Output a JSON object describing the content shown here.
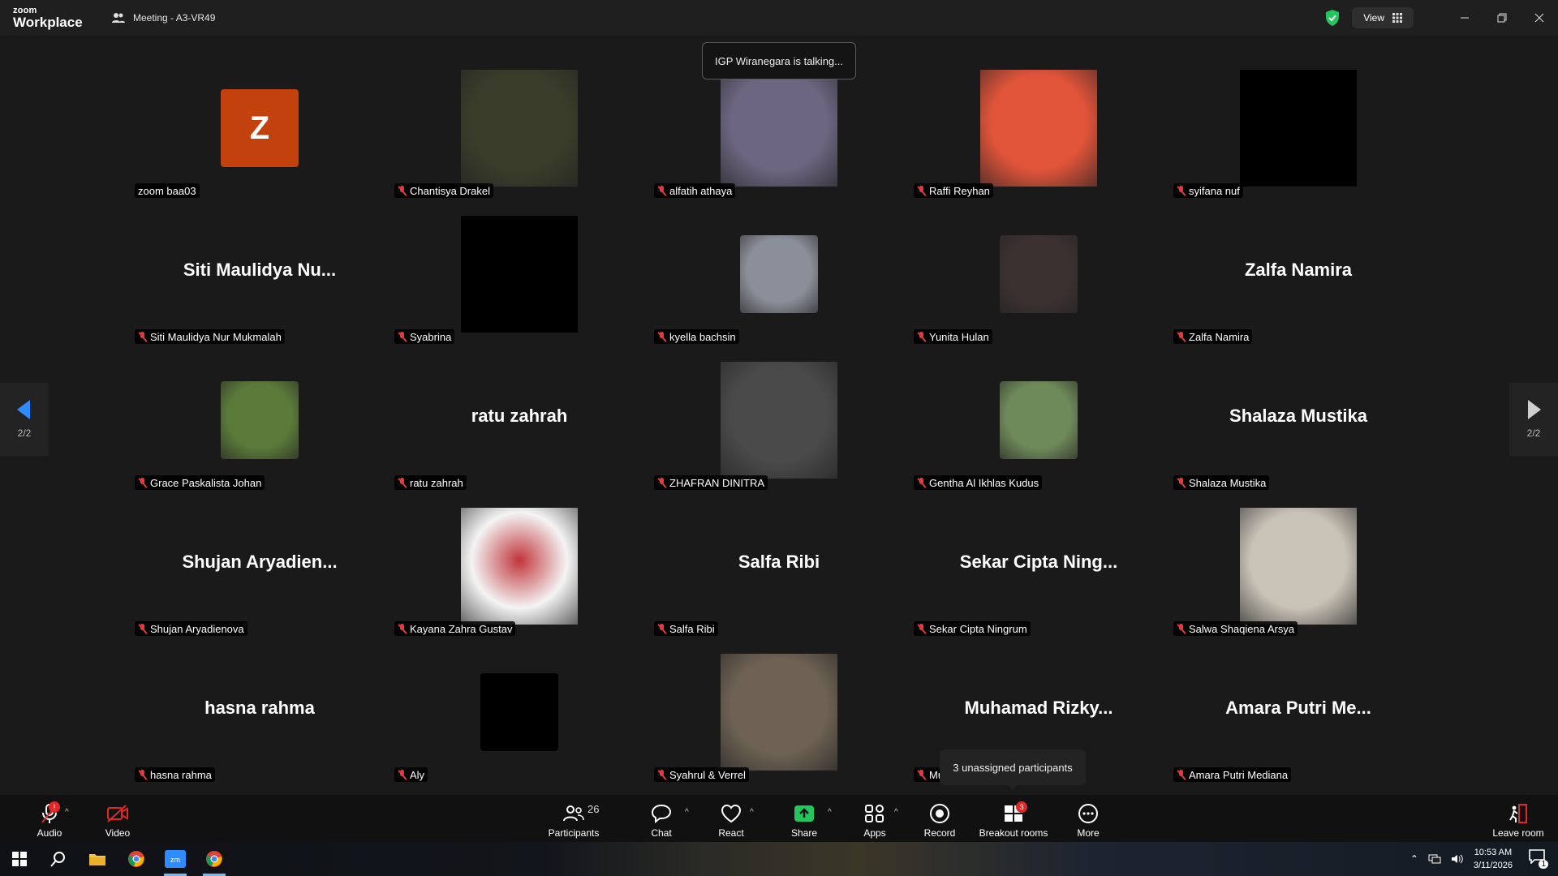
{
  "titlebar": {
    "logo_top": "zoom",
    "logo_bottom": "Workplace",
    "meeting_title": "Meeting - A3-VR49",
    "view_label": "View"
  },
  "talking_indicator": "IGP Wiranegara is talking...",
  "tooltip": "3 unassigned participants",
  "pager": {
    "left_label": "2/2",
    "right_label": "2/2"
  },
  "tiles": [
    {
      "name": "zoom baa03",
      "type": "letter",
      "letter": "Z",
      "muted": false
    },
    {
      "name": "Chantisya Drakel",
      "type": "photo",
      "color": "#3a3d2a",
      "muted": true
    },
    {
      "name": "alfatih athaya",
      "type": "photo",
      "color": "#6c6680",
      "muted": true
    },
    {
      "name": "Raffi Reyhan",
      "type": "photo",
      "color": "#e0543a",
      "muted": true
    },
    {
      "name": "syifana nuf",
      "type": "black",
      "muted": true
    },
    {
      "name": "Siti Maulidya Nur Mukmalah",
      "type": "text",
      "display": "Siti  Maulidya  Nu...",
      "muted": true
    },
    {
      "name": "Syabrina",
      "type": "black",
      "muted": true
    },
    {
      "name": "kyella bachsin",
      "type": "photo-sq",
      "color": "#8a8f99",
      "muted": true
    },
    {
      "name": "Yunita Hulan",
      "type": "photo-sq",
      "color": "#3b3230",
      "muted": true
    },
    {
      "name": "Zalfa Namira",
      "type": "text",
      "display": "Zalfa Namira",
      "muted": true
    },
    {
      "name": "Grace Paskalista Johan",
      "type": "photo-sq",
      "color": "#5b7a3a",
      "muted": true
    },
    {
      "name": "ratu zahrah",
      "type": "text",
      "display": "ratu zahrah",
      "muted": true
    },
    {
      "name": "ZHAFRAN DINITRA",
      "type": "photo",
      "color": "#4a4a4a",
      "muted": true
    },
    {
      "name": "Gentha Al Ikhlas Kudus",
      "type": "photo-sq",
      "color": "#6f8a5a",
      "muted": true
    },
    {
      "name": "Shalaza Mustika",
      "type": "text",
      "display": "Shalaza Mustika",
      "muted": true
    },
    {
      "name": "Shujan Aryadienova",
      "type": "text",
      "display": "Shujan  Aryadien...",
      "muted": true
    },
    {
      "name": "Kayana Zahra Gustav",
      "type": "photo",
      "color": "#f4f4f4",
      "accent": "#c0353b",
      "muted": true
    },
    {
      "name": "Salfa Ribi",
      "type": "text",
      "display": "Salfa Ribi",
      "muted": true
    },
    {
      "name": "Sekar Cipta Ningrum",
      "type": "text",
      "display": "Sekar Cipta Ning...",
      "muted": true
    },
    {
      "name": "Salwa Shaqiena Arsya",
      "type": "photo",
      "color": "#c9c2b7",
      "muted": true
    },
    {
      "name": "hasna rahma",
      "type": "text",
      "display": "hasna rahma",
      "muted": true
    },
    {
      "name": "Aly",
      "type": "black-sq",
      "muted": true
    },
    {
      "name": "Syahrul & Verrel",
      "type": "photo",
      "color": "#6d6253",
      "muted": true
    },
    {
      "name": "Mu",
      "type": "text",
      "display": "Muhamad  Rizky...",
      "muted": true
    },
    {
      "name": "Amara Putri Mediana",
      "type": "text",
      "display": "Amara Putri Me...",
      "muted": true
    }
  ],
  "toolbar": {
    "audio": "Audio",
    "video": "Video",
    "participants": "Participants",
    "participants_count": "26",
    "chat": "Chat",
    "react": "React",
    "share": "Share",
    "apps": "Apps",
    "record": "Record",
    "breakout": "Breakout rooms",
    "breakout_badge": "3",
    "more": "More",
    "leave": "Leave room"
  },
  "taskbar": {
    "time": "10:53 AM",
    "date": "3/11/2026",
    "notification_count": "1"
  },
  "colors": {
    "accent_blue": "#2d8cff",
    "share_green": "#22c55e",
    "muted_red": "#e23b3b",
    "letter_avatar": "#c2410c"
  }
}
